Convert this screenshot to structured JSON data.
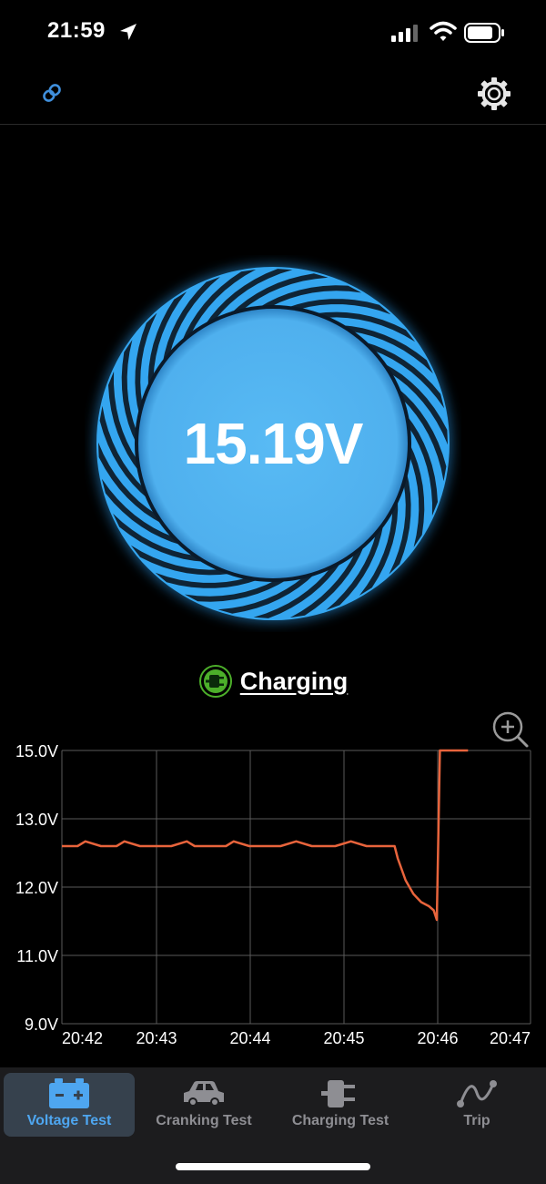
{
  "status_bar": {
    "time": "21:59"
  },
  "gauge": {
    "voltage": "15.19V"
  },
  "status": {
    "label": "Charging"
  },
  "chart_data": {
    "type": "line",
    "y_tick_labels": [
      "15.0V",
      "13.0V",
      "12.0V",
      "11.0V",
      "9.0V"
    ],
    "x_tick_labels": [
      "20:42",
      "20:43",
      "20:44",
      "20:45",
      "20:46",
      "20:47"
    ],
    "series": [
      {
        "color": "#e8643c",
        "x": [
          "20:42:00",
          "20:42:10",
          "20:42:15",
          "20:42:25",
          "20:42:35",
          "20:42:40",
          "20:42:50",
          "20:43:00",
          "20:43:10",
          "20:43:20",
          "20:43:25",
          "20:43:35",
          "20:43:45",
          "20:43:50",
          "20:44:00",
          "20:44:10",
          "20:44:20",
          "20:44:30",
          "20:44:40",
          "20:44:50",
          "20:44:55",
          "20:45:05",
          "20:45:15",
          "20:45:20",
          "20:45:30",
          "20:45:33",
          "20:45:35",
          "20:45:40",
          "20:45:45",
          "20:45:50",
          "20:45:55",
          "20:45:58",
          "20:46:00",
          "20:46:02",
          "20:46:10",
          "20:46:20"
        ],
        "y": [
          12.6,
          12.6,
          12.67,
          12.6,
          12.6,
          12.67,
          12.6,
          12.6,
          12.6,
          12.67,
          12.6,
          12.6,
          12.6,
          12.67,
          12.6,
          12.6,
          12.6,
          12.67,
          12.6,
          12.6,
          12.6,
          12.67,
          12.6,
          12.6,
          12.6,
          12.6,
          12.42,
          12.1,
          11.9,
          11.78,
          11.72,
          11.66,
          11.52,
          15.0,
          15.0,
          15.0
        ]
      }
    ],
    "grid": true
  },
  "tabs": [
    {
      "label": "Voltage Test",
      "icon": "battery-icon",
      "active": true
    },
    {
      "label": "Cranking Test",
      "icon": "car-icon",
      "active": false
    },
    {
      "label": "Charging Test",
      "icon": "plug-icon",
      "active": false
    },
    {
      "label": "Trip",
      "icon": "route-icon",
      "active": false
    }
  ],
  "colors": {
    "accent": "#4ea6f0",
    "gauge": "#53b6f3",
    "line": "#e8643c",
    "charging": "#4caf2a"
  }
}
